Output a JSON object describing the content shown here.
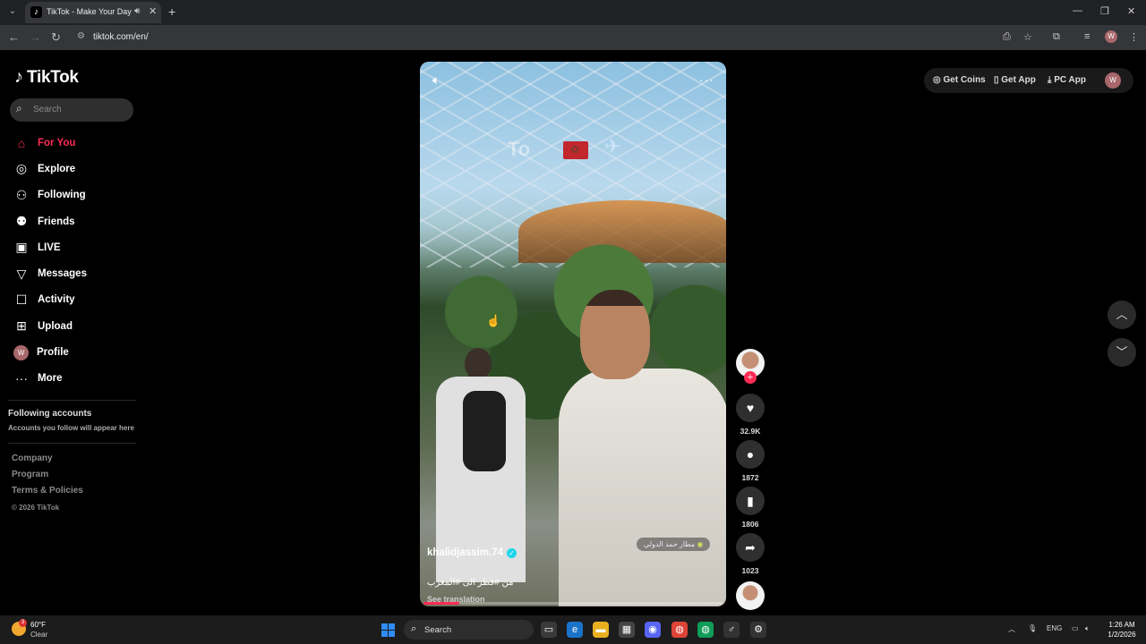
{
  "browser": {
    "tab_title": "TikTok - Make Your Day",
    "url": "tiktok.com/en/",
    "profile_initial": "W"
  },
  "sidebar": {
    "logo": "TikTok",
    "search_placeholder": "Search",
    "nav": [
      {
        "label": "For You",
        "icon": "home-icon",
        "active": true
      },
      {
        "label": "Explore",
        "icon": "compass-icon"
      },
      {
        "label": "Following",
        "icon": "following-icon"
      },
      {
        "label": "Friends",
        "icon": "friends-icon"
      },
      {
        "label": "LIVE",
        "icon": "live-icon"
      },
      {
        "label": "Messages",
        "icon": "messages-icon"
      },
      {
        "label": "Activity",
        "icon": "activity-icon"
      },
      {
        "label": "Upload",
        "icon": "upload-icon"
      },
      {
        "label": "Profile",
        "icon": "avatar"
      },
      {
        "label": "More",
        "icon": "more-icon"
      }
    ],
    "profile_initial": "W",
    "following_heading": "Following accounts",
    "following_sub": "Accounts you follow will appear here",
    "footer": [
      "Company",
      "Program",
      "Terms & Policies"
    ],
    "copyright": "© 2026 TikTok"
  },
  "video": {
    "overlay_text": "To",
    "username": "khalidjassim.74",
    "caption": "من #قطر الى #المغرب",
    "see_translation": "See translation",
    "location": "مطار حمد الدولي",
    "progress": 0.12
  },
  "actions": {
    "likes": "32.9K",
    "comments": "1872",
    "bookmarks": "1806",
    "shares": "1023"
  },
  "top_right": {
    "get_coins": "Get Coins",
    "get_app": "Get App",
    "pc_app": "PC App",
    "avatar_initial": "W"
  },
  "taskbar": {
    "temp": "60°F",
    "condition": "Clear",
    "weather_badge": "3",
    "search_label": "Search",
    "lang": "ENG",
    "time": "1:26 AM",
    "date": "1/2/2026"
  },
  "colors": {
    "accent": "#fe2c55",
    "verified": "#20d5ec",
    "background": "#000000"
  }
}
